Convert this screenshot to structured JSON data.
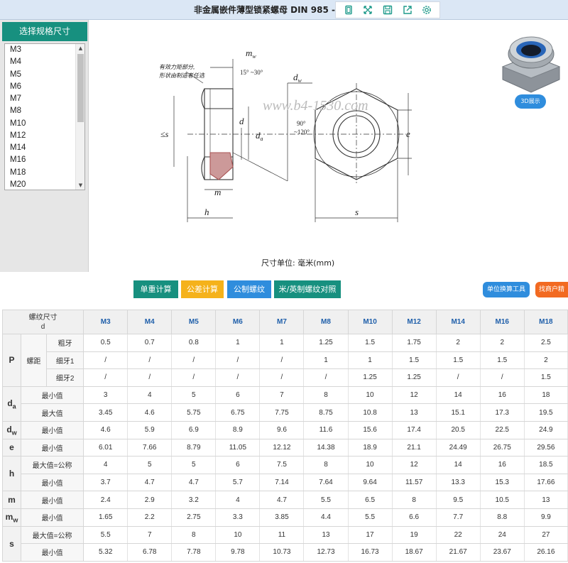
{
  "window": {
    "title": "非金属嵌件薄型锁紧螺母 DIN 985 -"
  },
  "toolbar": {
    "icons": [
      "window-restore-icon",
      "fullscreen-icon",
      "save-icon",
      "share-icon",
      "settings-icon"
    ]
  },
  "spec_panel": {
    "header": "选择规格尺寸",
    "items": [
      "M3",
      "M4",
      "M5",
      "M6",
      "M7",
      "M8",
      "M10",
      "M12",
      "M14",
      "M16",
      "M18",
      "M20"
    ]
  },
  "drawing": {
    "note_line1": "有效力矩部分,",
    "note_line2": "形状由制造者任选",
    "watermark": "www.b4-1530.com",
    "labels": {
      "mw": "m",
      "mw_sub": "w",
      "angle_top": "15° ~30°",
      "dw": "d",
      "dw_sub": "w",
      "s_left": "≤s",
      "d": "d",
      "da": "d",
      "da_sub": "a",
      "angle_90_a": "90°",
      "angle_90_b": "~120°",
      "e": "e",
      "m": "m",
      "h": "h",
      "s": "s"
    }
  },
  "unit_label": "尺寸单位: 毫米(mm)",
  "model_button": "3D展示",
  "buttons": {
    "weight": "单重计算",
    "tolerance": "公差计算",
    "metric_thread": "公制螺纹",
    "metric_imperial": "米/英制螺纹对照",
    "unit_tool": "单位换算工具",
    "find_supplier": "找商户精"
  },
  "table": {
    "corner_line1": "螺纹尺寸",
    "corner_line2": "d",
    "columns": [
      "M3",
      "M4",
      "M5",
      "M6",
      "M7",
      "M8",
      "M10",
      "M12",
      "M14",
      "M16",
      "M18"
    ],
    "groups": [
      {
        "sym": "P",
        "sub": "",
        "label": "螺距",
        "rows": [
          {
            "label": "粗牙",
            "values": [
              "0.5",
              "0.7",
              "0.8",
              "1",
              "1",
              "1.25",
              "1.5",
              "1.75",
              "2",
              "2",
              "2.5"
            ]
          },
          {
            "label": "细牙1",
            "values": [
              "/",
              "/",
              "/",
              "/",
              "/",
              "1",
              "1",
              "1.5",
              "1.5",
              "1.5",
              "2"
            ]
          },
          {
            "label": "细牙2",
            "values": [
              "/",
              "/",
              "/",
              "/",
              "/",
              "/",
              "1.25",
              "1.25",
              "/",
              "/",
              "1.5"
            ]
          }
        ]
      },
      {
        "sym": "d",
        "sub": "a",
        "rows": [
          {
            "label": "最小值",
            "values": [
              "3",
              "4",
              "5",
              "6",
              "7",
              "8",
              "10",
              "12",
              "14",
              "16",
              "18"
            ]
          },
          {
            "label": "最大值",
            "values": [
              "3.45",
              "4.6",
              "5.75",
              "6.75",
              "7.75",
              "8.75",
              "10.8",
              "13",
              "15.1",
              "17.3",
              "19.5"
            ]
          }
        ]
      },
      {
        "sym": "d",
        "sub": "w",
        "rows": [
          {
            "label": "最小值",
            "values": [
              "4.6",
              "5.9",
              "6.9",
              "8.9",
              "9.6",
              "11.6",
              "15.6",
              "17.4",
              "20.5",
              "22.5",
              "24.9"
            ]
          }
        ]
      },
      {
        "sym": "e",
        "sub": "",
        "rows": [
          {
            "label": "最小值",
            "values": [
              "6.01",
              "7.66",
              "8.79",
              "11.05",
              "12.12",
              "14.38",
              "18.9",
              "21.1",
              "24.49",
              "26.75",
              "29.56"
            ]
          }
        ]
      },
      {
        "sym": "h",
        "sub": "",
        "rows": [
          {
            "label": "最大值=公称",
            "values": [
              "4",
              "5",
              "5",
              "6",
              "7.5",
              "8",
              "10",
              "12",
              "14",
              "16",
              "18.5"
            ]
          },
          {
            "label": "最小值",
            "values": [
              "3.7",
              "4.7",
              "4.7",
              "5.7",
              "7.14",
              "7.64",
              "9.64",
              "11.57",
              "13.3",
              "15.3",
              "17.66"
            ]
          }
        ]
      },
      {
        "sym": "m",
        "sub": "",
        "rows": [
          {
            "label": "最小值",
            "values": [
              "2.4",
              "2.9",
              "3.2",
              "4",
              "4.7",
              "5.5",
              "6.5",
              "8",
              "9.5",
              "10.5",
              "13"
            ]
          }
        ]
      },
      {
        "sym": "m",
        "sub": "w",
        "rows": [
          {
            "label": "最小值",
            "values": [
              "1.65",
              "2.2",
              "2.75",
              "3.3",
              "3.85",
              "4.4",
              "5.5",
              "6.6",
              "7.7",
              "8.8",
              "9.9"
            ]
          }
        ]
      },
      {
        "sym": "s",
        "sub": "",
        "rows": [
          {
            "label": "最大值=公称",
            "values": [
              "5.5",
              "7",
              "8",
              "10",
              "11",
              "13",
              "17",
              "19",
              "22",
              "24",
              "27"
            ]
          },
          {
            "label": "最小值",
            "values": [
              "5.32",
              "6.78",
              "7.78",
              "9.78",
              "10.73",
              "12.73",
              "16.73",
              "18.67",
              "21.67",
              "23.67",
              "26.16"
            ]
          }
        ]
      }
    ]
  }
}
